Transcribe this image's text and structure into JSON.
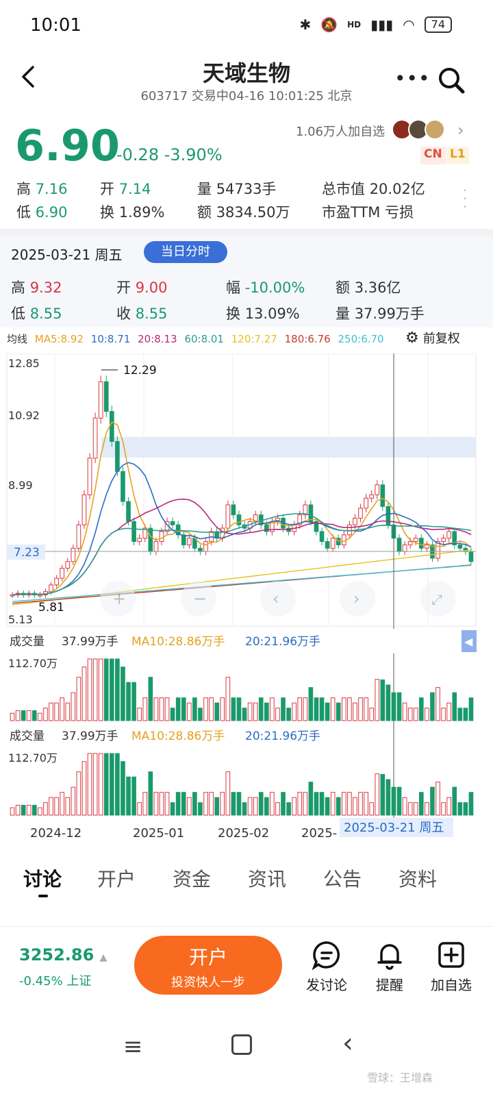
{
  "status_bar": {
    "time": "10:01",
    "battery": "74",
    "network": "HD"
  },
  "header": {
    "stock_name": "天域生物",
    "subtitle": "603717 交易中04-16 10:01:25 北京"
  },
  "quote": {
    "price": "6.90",
    "change": "-0.28 -3.90%",
    "followers": "1.06万人加自选",
    "badge_cn": "CN",
    "badge_l1": "L1",
    "stats": [
      {
        "label": "高",
        "value": "7.16"
      },
      {
        "label": "开",
        "value": "7.14"
      },
      {
        "label": "量",
        "value": "54733手"
      },
      {
        "label": "总市值",
        "value": "20.02亿"
      },
      {
        "label": "低",
        "value": "6.90"
      },
      {
        "label": "换",
        "value": "1.89%"
      },
      {
        "label": "额",
        "value": "3834.50万"
      },
      {
        "label": "市盈TTM",
        "value": "亏损"
      }
    ]
  },
  "history": {
    "date": "2025-03-21 周五",
    "button": "当日分时",
    "stats": [
      {
        "label": "高",
        "value": "9.32"
      },
      {
        "label": "开",
        "value": "9.00"
      },
      {
        "label": "幅",
        "value": "-10.00%"
      },
      {
        "label": "额",
        "value": "3.36亿"
      },
      {
        "label": "低",
        "value": "8.55"
      },
      {
        "label": "收",
        "value": "8.55"
      },
      {
        "label": "换",
        "value": "13.09%"
      },
      {
        "label": "量",
        "value": "37.99万手"
      }
    ]
  },
  "ma_legend": {
    "label": "均线",
    "items": [
      {
        "text": "MA5:8.92",
        "color": "#e8a020"
      },
      {
        "text": "10:8.71",
        "color": "#2b6cc4"
      },
      {
        "text": "20:8.13",
        "color": "#b5287a"
      },
      {
        "text": "60:8.01",
        "color": "#2a9d8f"
      },
      {
        "text": "120:7.27",
        "color": "#e6c21c"
      },
      {
        "text": "180:6.76",
        "color": "#c0392b"
      },
      {
        "text": "250:6.70",
        "color": "#3ec0d0"
      }
    ],
    "adjust": "前复权"
  },
  "chart_data": {
    "type": "candlestick",
    "y_ticks": [
      "12.85",
      "10.92",
      "8.99",
      "7.23",
      "5.13"
    ],
    "high_marker": "12.29",
    "low_marker": "5.81",
    "current_line": "7.23",
    "x_labels": [
      "2024-12",
      "2025-01",
      "2025-02",
      "2025-",
      "2025-03-21 周五"
    ],
    "closes": [
      5.9,
      5.95,
      5.9,
      5.95,
      5.9,
      5.9,
      6.0,
      6.2,
      6.4,
      6.7,
      6.9,
      7.3,
      8.0,
      8.9,
      10.0,
      11.2,
      12.29,
      11.4,
      10.5,
      9.6,
      8.7,
      8.1,
      7.5,
      7.6,
      7.9,
      7.2,
      7.5,
      7.8,
      8.1,
      8.0,
      7.7,
      7.4,
      7.6,
      7.3,
      7.2,
      7.5,
      7.8,
      7.6,
      7.9,
      8.6,
      8.3,
      8.0,
      7.9,
      8.1,
      8.3,
      8.0,
      7.8,
      8.1,
      8.2,
      7.9,
      7.8,
      8.0,
      8.3,
      8.6,
      8.1,
      7.8,
      7.5,
      7.3,
      7.6,
      7.4,
      7.7,
      8.0,
      8.2,
      8.5,
      8.8,
      8.9,
      9.2,
      8.55,
      8.0,
      7.6,
      7.2,
      7.4,
      7.5,
      7.6,
      7.3,
      7.4,
      7.0,
      7.5,
      7.6,
      7.8,
      7.4,
      7.3,
      7.2,
      6.9
    ],
    "volume_legend": {
      "label": "成交量",
      "vol": "37.99万手",
      "ma10": "MA10:28.86万手",
      "ma20": "20:21.96万手",
      "max": "112.70万"
    }
  },
  "tabs": [
    "讨论",
    "开户",
    "资金",
    "资讯",
    "公告",
    "资料"
  ],
  "bottom": {
    "index_value": "3252.86",
    "index_sub": "-0.45% 上证",
    "open_title": "开户",
    "open_sub": "投资快人一步",
    "actions": [
      "发讨论",
      "提醒",
      "加自选"
    ]
  },
  "watermark": "雪球：王增森"
}
